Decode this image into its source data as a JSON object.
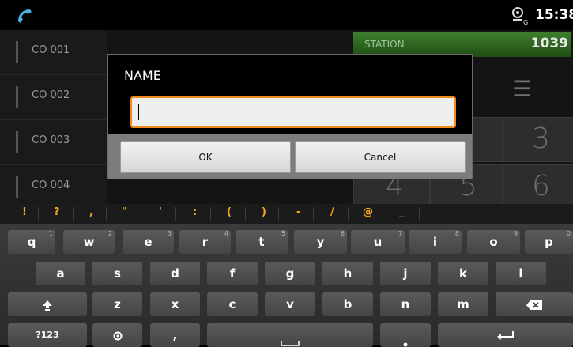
{
  "status_bar": {
    "time": "15:38"
  },
  "app": {
    "co_items": [
      "CO 001",
      "CO 002",
      "CO 003",
      "CO 004"
    ],
    "station_label": "STATION",
    "station_number": "1039",
    "dial_digits": [
      "3",
      "4",
      "5",
      "6"
    ]
  },
  "dialog": {
    "title": "NAME",
    "input_value": "",
    "ok_label": "OK",
    "cancel_label": "Cancel"
  },
  "suggestions": [
    "!",
    "?",
    ",",
    "\"",
    "'",
    ":",
    "(",
    ")",
    "-",
    "/",
    "@",
    "_"
  ],
  "keyboard": {
    "row1": [
      {
        "k": "q",
        "h": "1"
      },
      {
        "k": "w",
        "h": "2"
      },
      {
        "k": "e",
        "h": "3"
      },
      {
        "k": "r",
        "h": "4"
      },
      {
        "k": "t",
        "h": "5"
      },
      {
        "k": "y",
        "h": "6"
      },
      {
        "k": "u",
        "h": "7"
      },
      {
        "k": "i",
        "h": "8"
      },
      {
        "k": "o",
        "h": "9"
      },
      {
        "k": "p",
        "h": "0"
      }
    ],
    "row2": [
      "a",
      "s",
      "d",
      "f",
      "g",
      "h",
      "j",
      "k",
      "l"
    ],
    "row3": [
      "z",
      "x",
      "c",
      "v",
      "b",
      "n",
      "m"
    ],
    "symbols_label": "?123",
    "comma_label": ","
  },
  "colors": {
    "accent": "#f08a1a",
    "station_green": "#3f7f2c",
    "suggest": "#f5a623"
  }
}
